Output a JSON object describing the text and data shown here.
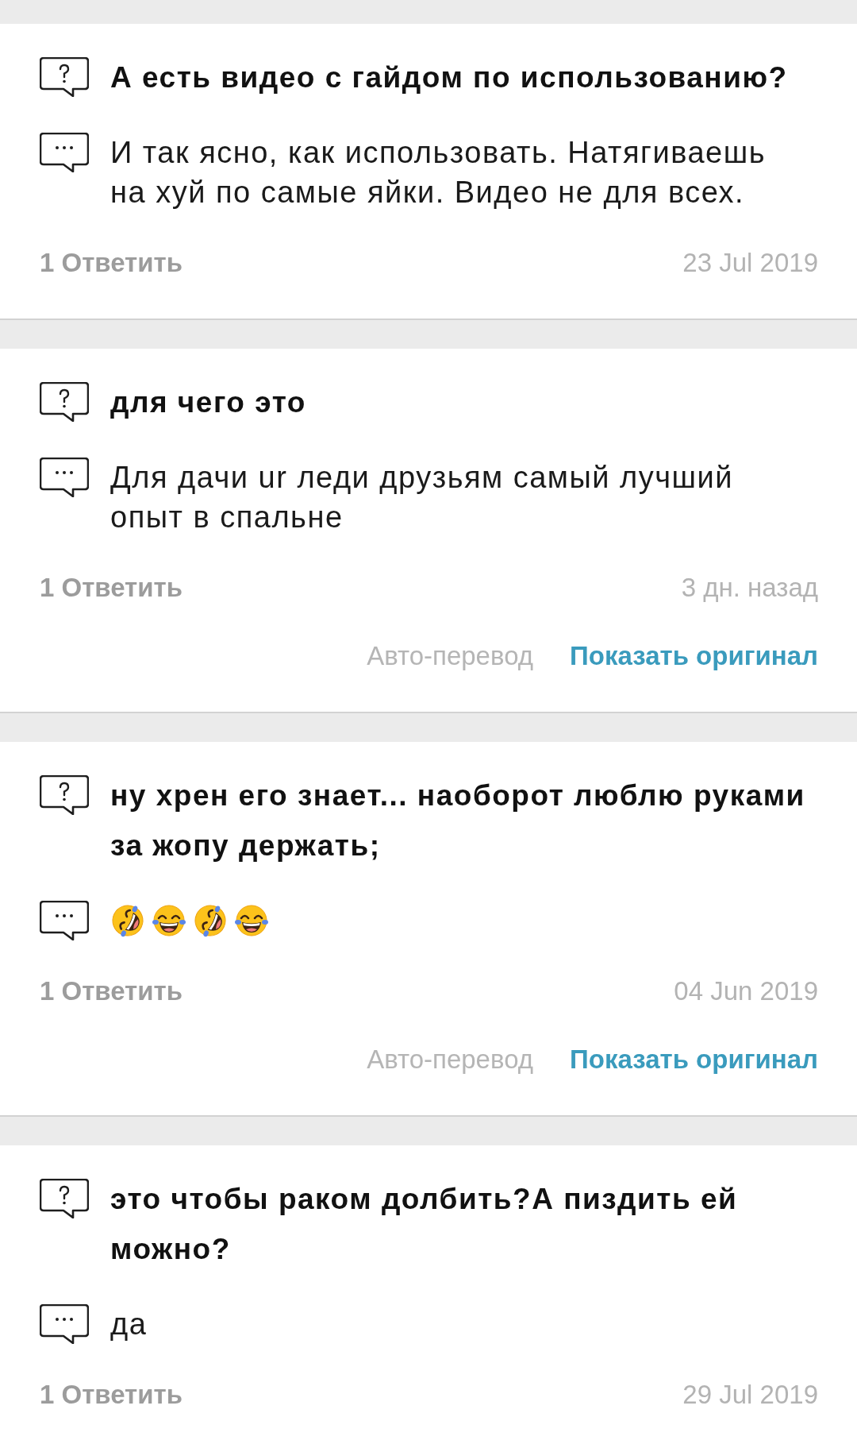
{
  "questions": [
    {
      "question": "А есть видео с гайдом по использованию?",
      "answer": {
        "kind": "text",
        "text": "И так ясно, как использовать. Натягиваешь на хуй по самые яйки. Видео не для всех."
      },
      "reply": "1 Ответить",
      "date": "23 Jul 2019"
    },
    {
      "question": "для чего это",
      "answer": {
        "kind": "text",
        "text": "Для дачи ur леди друзьям самый лучший опыт в спальне"
      },
      "reply": "1 Ответить",
      "date": "3 дн. назад",
      "translation": {
        "label": "Авто-перевод",
        "link": "Показать оригинал"
      }
    },
    {
      "question": "ну хрен его знает... наоборот люблю руками за жопу держать;",
      "answer": {
        "kind": "emoji",
        "emoji": [
          {
            "kind": "rolling"
          },
          {
            "kind": "joy"
          },
          {
            "kind": "rolling"
          },
          {
            "kind": "joy"
          }
        ]
      },
      "reply": "1 Ответить",
      "date": "04 Jun 2019",
      "translation": {
        "label": "Авто-перевод",
        "link": "Показать оригинал"
      }
    },
    {
      "question": "это чтобы раком долбить?А пиздить ей можно?",
      "answer": {
        "kind": "text",
        "text": "да"
      },
      "reply": "1 Ответить",
      "date": "29 Jul 2019"
    }
  ]
}
